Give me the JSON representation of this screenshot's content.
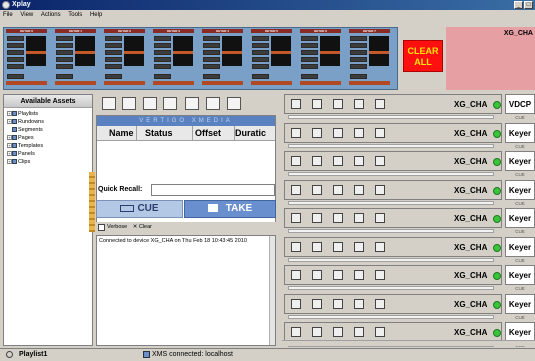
{
  "window": {
    "title": "Xplay",
    "min_label": "_",
    "max_label": "□"
  },
  "menu": [
    "File",
    "View",
    "Actions",
    "Tools",
    "Help"
  ],
  "keyers": [
    {
      "label": "KEYER 0"
    },
    {
      "label": "KEYER 1"
    },
    {
      "label": "KEYER 2"
    },
    {
      "label": "KEYER 3"
    },
    {
      "label": "KEYER 4"
    },
    {
      "label": "KEYER 5"
    },
    {
      "label": "KEYER 6"
    },
    {
      "label": "KEYER 7"
    }
  ],
  "clear_all": {
    "line1": "CLEAR",
    "line2": "ALL"
  },
  "right_top": {
    "label": "XG_CHA"
  },
  "assets": {
    "title": "Available Assets",
    "items": [
      "Playlists",
      "Rundowns",
      "Segments",
      "Pages",
      "Templates",
      "Panels",
      "Clips"
    ]
  },
  "playlist": {
    "banner": "VERTIGO XMEDIA",
    "columns": [
      "Name",
      "Status",
      "Offset",
      "Duratic"
    ]
  },
  "quick_recall": {
    "label": "Quick Recall:",
    "value": ""
  },
  "cue_label": "CUE",
  "take_label": "TAKE",
  "log": {
    "verbose_label": "Verbose",
    "clear_label": "Clear",
    "message": "Connected to device XG_CHA on Thu Feb 18 10:43:45 2010"
  },
  "channels": [
    {
      "name": "XG_CHA",
      "side": "VDCP",
      "cue": "CUE"
    },
    {
      "name": "XG_CHA",
      "side": "Keyer",
      "cue": "CUE"
    },
    {
      "name": "XG_CHA",
      "side": "Keyer",
      "cue": "CUE"
    },
    {
      "name": "XG_CHA",
      "side": "Keyer",
      "cue": "CUE"
    },
    {
      "name": "XG_CHA",
      "side": "Keyer",
      "cue": "CUE"
    },
    {
      "name": "XG_CHA",
      "side": "Keyer",
      "cue": "CUE"
    },
    {
      "name": "XG_CHA",
      "side": "Keyer",
      "cue": "CUE"
    },
    {
      "name": "XG_CHA",
      "side": "Keyer",
      "cue": "CUE"
    },
    {
      "name": "XG_CHA",
      "side": "Keyer",
      "cue": "CUE"
    }
  ],
  "status": {
    "name": "Playlist1",
    "connection": "XMS connected: localhost"
  },
  "colors": {
    "clear_all": "#ff1010",
    "led": "#39c43a",
    "banner": "#5a82c0",
    "keyer_strip": "#7aa0c8"
  }
}
